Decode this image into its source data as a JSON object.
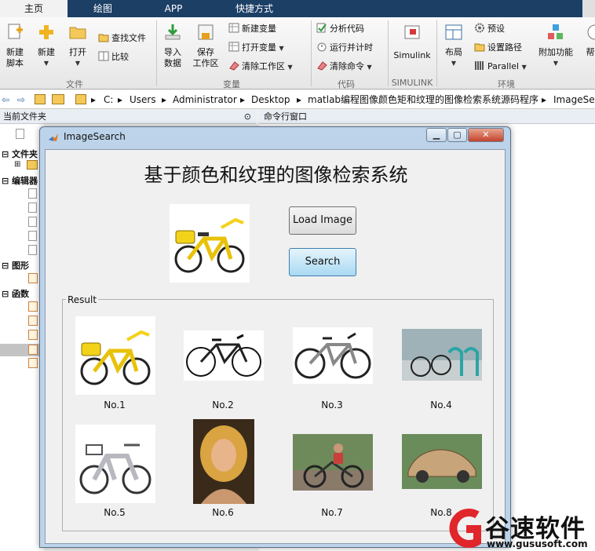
{
  "tabs": [
    "主页",
    "绘图",
    "APP",
    "快捷方式"
  ],
  "ribbon": {
    "new_script": "新建\n脚本",
    "new": "新建",
    "open": "打开",
    "find_files": "查找文件",
    "compare": "比较",
    "group_file": "文件",
    "import_data": "导入\n数据",
    "save_workspace": "保存\n工作区",
    "new_variable": "新建变量",
    "open_variable": "打开变量",
    "clear_workspace": "清除工作区",
    "group_variable": "变量",
    "analyze_code": "分析代码",
    "run_timer": "运行并计时",
    "clear_commands": "清除命令",
    "group_code": "代码",
    "simulink": "Simulink",
    "group_simulink": "SIMULINK",
    "layout": "布局",
    "preferences": "预设",
    "set_path": "设置路径",
    "parallel": "Parallel",
    "group_env": "环境",
    "addons": "附加功能",
    "help": "帮"
  },
  "path": [
    "C:",
    "Users",
    "Administrator",
    "Desktop",
    "matlab编程图像颜色矩和纹理的图像检索系统源码程序",
    "ImageSe"
  ],
  "panes": {
    "current_folder": "当前文件夹",
    "command_window": "命令行窗口",
    "tree_folder": "文件夹",
    "tree_editor": "编辑器",
    "tree_figure": "图形",
    "tree_function": "函数"
  },
  "window": {
    "title": "ImageSearch",
    "app_title": "基于颜色和纹理的图像检索系统",
    "load_button": "Load Image",
    "search_button": "Search",
    "result_label": "Result"
  },
  "results": [
    "No.1",
    "No.2",
    "No.3",
    "No.4",
    "No.5",
    "No.6",
    "No.7",
    "No.8"
  ],
  "watermark": {
    "name": "谷速软件",
    "url": "www.gususoft.com"
  },
  "colors": {
    "tabbar": "#1c3f66",
    "window_frame": "#bcd3ea",
    "search_focus": "#a9d9f2",
    "watermark_red": "#e0262b"
  }
}
